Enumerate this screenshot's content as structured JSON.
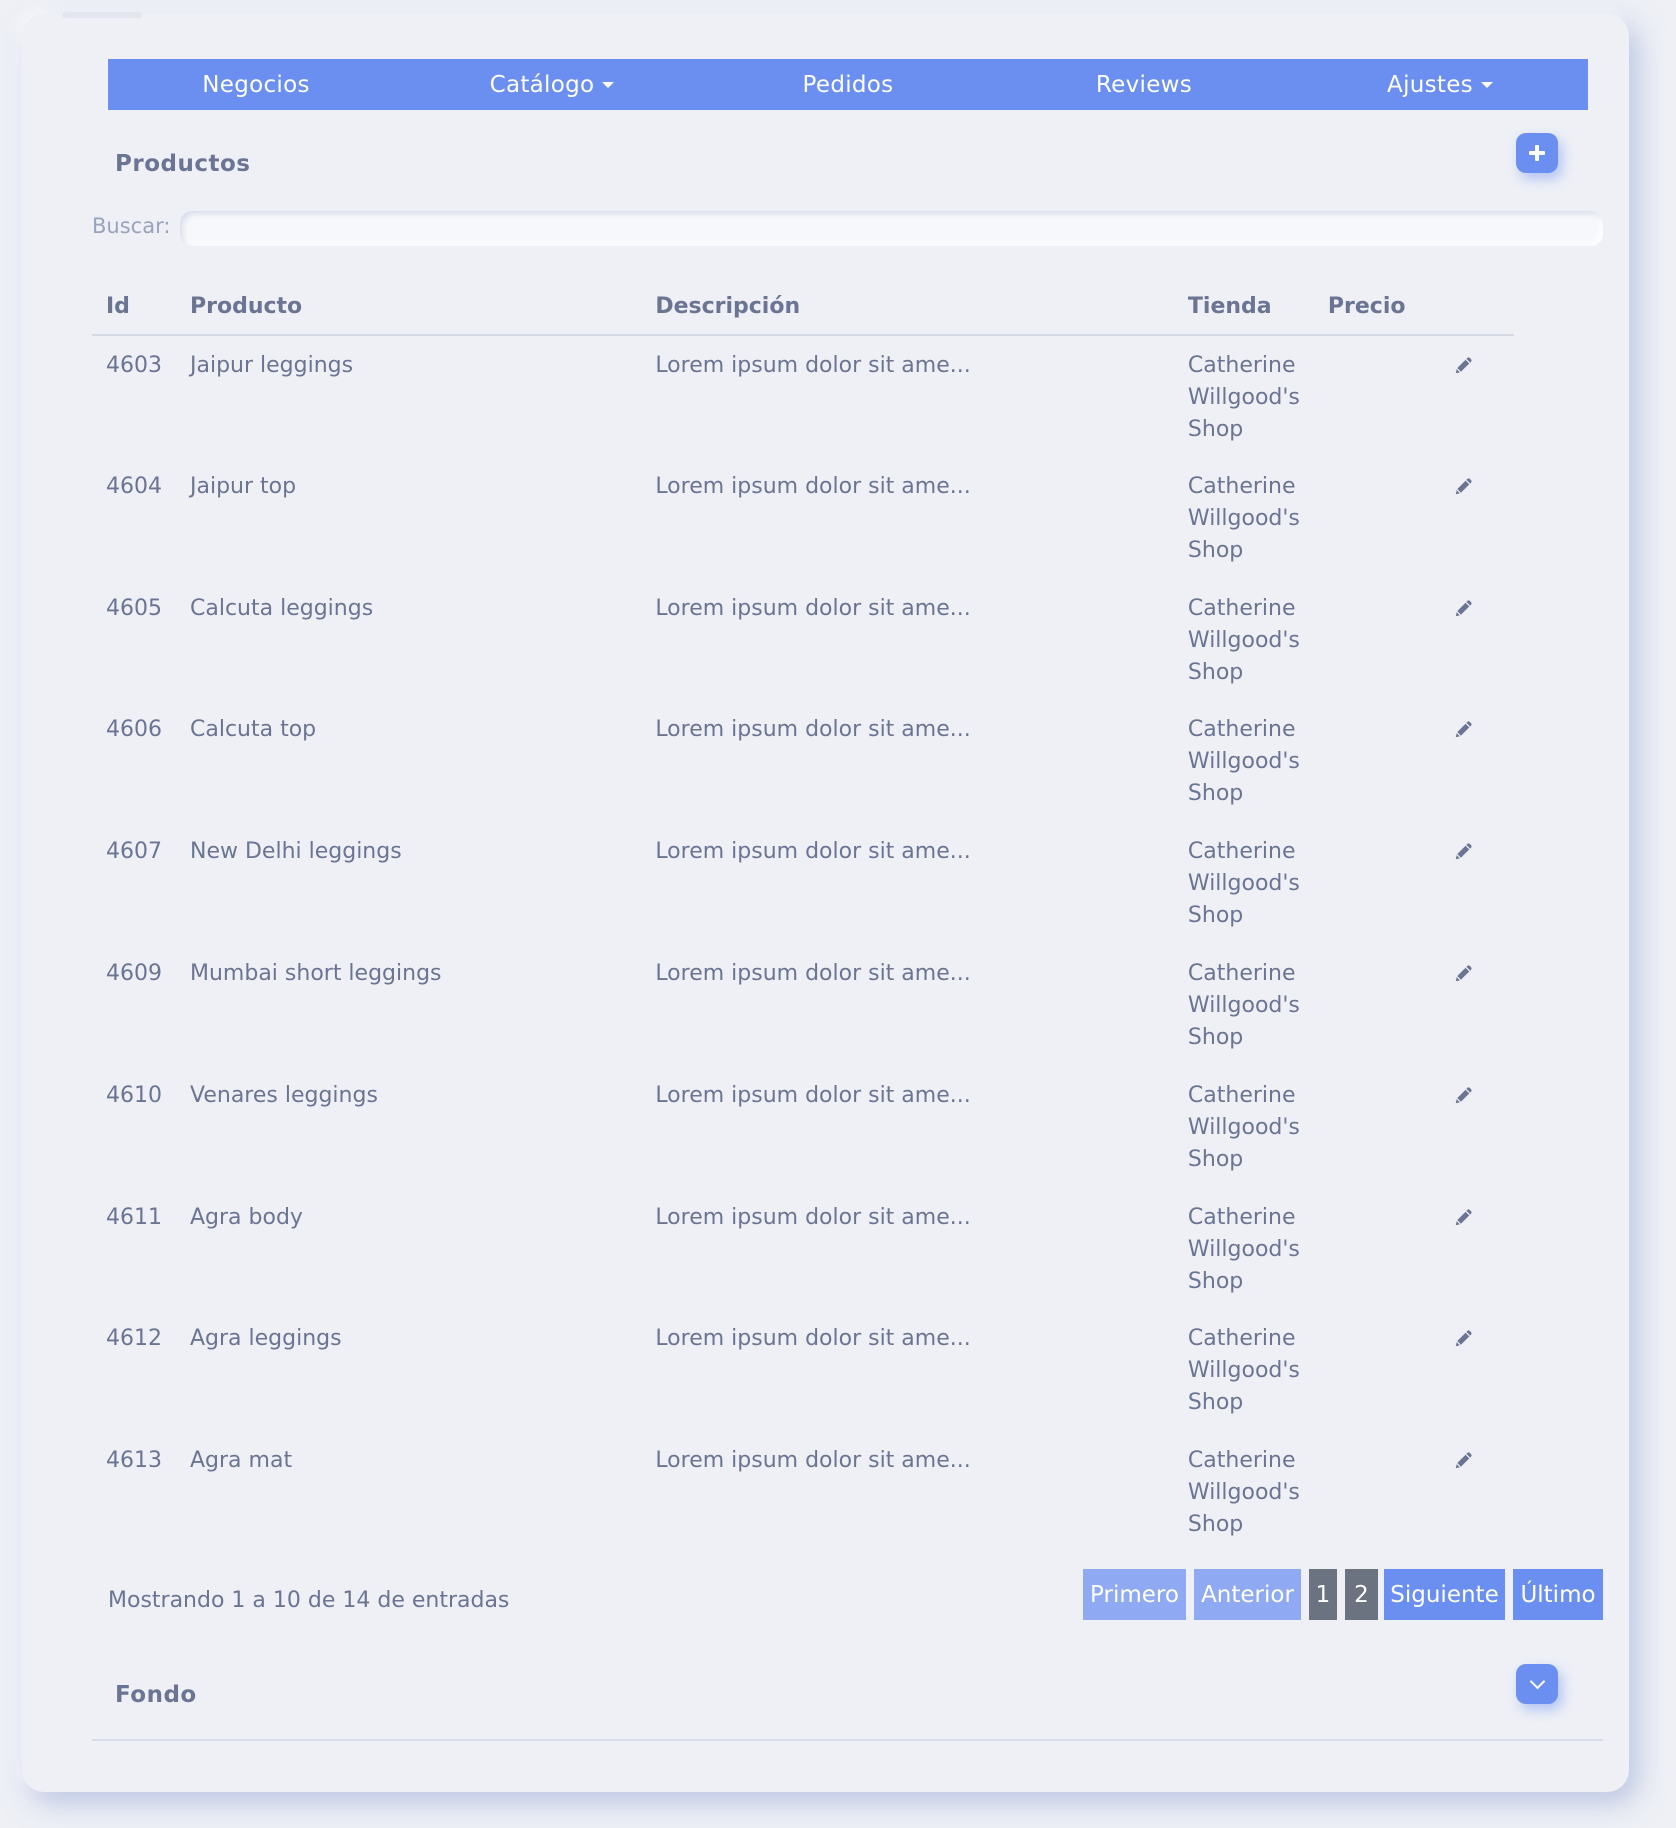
{
  "nav": {
    "items": [
      {
        "label": "Negocios",
        "dropdown": false
      },
      {
        "label": "Catálogo",
        "dropdown": true
      },
      {
        "label": "Pedidos",
        "dropdown": false
      },
      {
        "label": "Reviews",
        "dropdown": false
      },
      {
        "label": "Ajustes",
        "dropdown": true
      }
    ]
  },
  "products": {
    "title": "Productos",
    "add_icon": "plus-icon",
    "search_label": "Buscar:",
    "search_value": ""
  },
  "table": {
    "headers": [
      "Id",
      "Producto",
      "Descripción",
      "Tienda",
      "Precio",
      ""
    ],
    "rows": [
      {
        "id": "4603",
        "product": "Jaipur leggings",
        "description": "Lorem ipsum dolor sit ame...",
        "shop": "Catherine Willgood's Shop",
        "price": ""
      },
      {
        "id": "4604",
        "product": "Jaipur top",
        "description": "Lorem ipsum dolor sit ame...",
        "shop": "Catherine Willgood's Shop",
        "price": ""
      },
      {
        "id": "4605",
        "product": "Calcuta leggings",
        "description": "Lorem ipsum dolor sit ame...",
        "shop": "Catherine Willgood's Shop",
        "price": ""
      },
      {
        "id": "4606",
        "product": "Calcuta top",
        "description": "Lorem ipsum dolor sit ame...",
        "shop": "Catherine Willgood's Shop",
        "price": ""
      },
      {
        "id": "4607",
        "product": "New Delhi leggings",
        "description": "Lorem ipsum dolor sit ame...",
        "shop": "Catherine Willgood's Shop",
        "price": ""
      },
      {
        "id": "4609",
        "product": "Mumbai short leggings",
        "description": "Lorem ipsum dolor sit ame...",
        "shop": "Catherine Willgood's Shop",
        "price": ""
      },
      {
        "id": "4610",
        "product": "Venares leggings",
        "description": "Lorem ipsum dolor sit ame...",
        "shop": "Catherine Willgood's Shop",
        "price": ""
      },
      {
        "id": "4611",
        "product": "Agra body",
        "description": "Lorem ipsum dolor sit ame...",
        "shop": "Catherine Willgood's Shop",
        "price": ""
      },
      {
        "id": "4612",
        "product": "Agra leggings",
        "description": "Lorem ipsum dolor sit ame...",
        "shop": "Catherine Willgood's Shop",
        "price": ""
      },
      {
        "id": "4613",
        "product": "Agra mat",
        "description": "Lorem ipsum dolor sit ame...",
        "shop": "Catherine Willgood's Shop",
        "price": ""
      }
    ],
    "row_action_icon": "pencil-icon"
  },
  "pagination": {
    "info": "Mostrando 1 a 10 de 14 de entradas",
    "first": "Primero",
    "prev": "Anterior",
    "pages": [
      "1",
      "2"
    ],
    "next": "Siguiente",
    "last": "Último"
  },
  "footer": {
    "title": "Fondo",
    "toggle_icon": "chevron-down-icon"
  },
  "colors": {
    "accent": "#6b8ff0",
    "accent_light": "#8fa9f2",
    "page_dark": "#6b7280",
    "text": "#6b7593",
    "background": "#eef0f6"
  }
}
